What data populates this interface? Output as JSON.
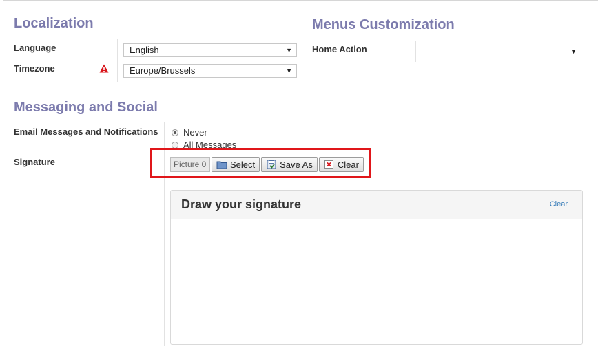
{
  "localization": {
    "title": "Localization",
    "language": {
      "label": "Language",
      "value": "English"
    },
    "timezone": {
      "label": "Timezone",
      "value": "Europe/Brussels"
    }
  },
  "menus": {
    "title": "Menus Customization",
    "home_action": {
      "label": "Home Action",
      "value": ""
    }
  },
  "messaging": {
    "title": "Messaging and Social",
    "email": {
      "label": "Email Messages and Notifications",
      "options": [
        "Never",
        "All Messages"
      ],
      "selected": "Never"
    },
    "signature": {
      "label": "Signature",
      "picture_field": "Picture 0",
      "select_label": "Select",
      "save_as_label": "Save As",
      "clear_label": "Clear"
    }
  },
  "signature_pad": {
    "title": "Draw your signature",
    "clear_label": "Clear"
  },
  "colors": {
    "section_title": "#7c7bad",
    "highlight": "#e0161a",
    "warning": "#d9161c",
    "link": "#337ab7"
  },
  "icons": [
    "warning-icon",
    "folder-icon",
    "save-icon",
    "clear-x-icon",
    "dropdown-arrow-icon"
  ]
}
